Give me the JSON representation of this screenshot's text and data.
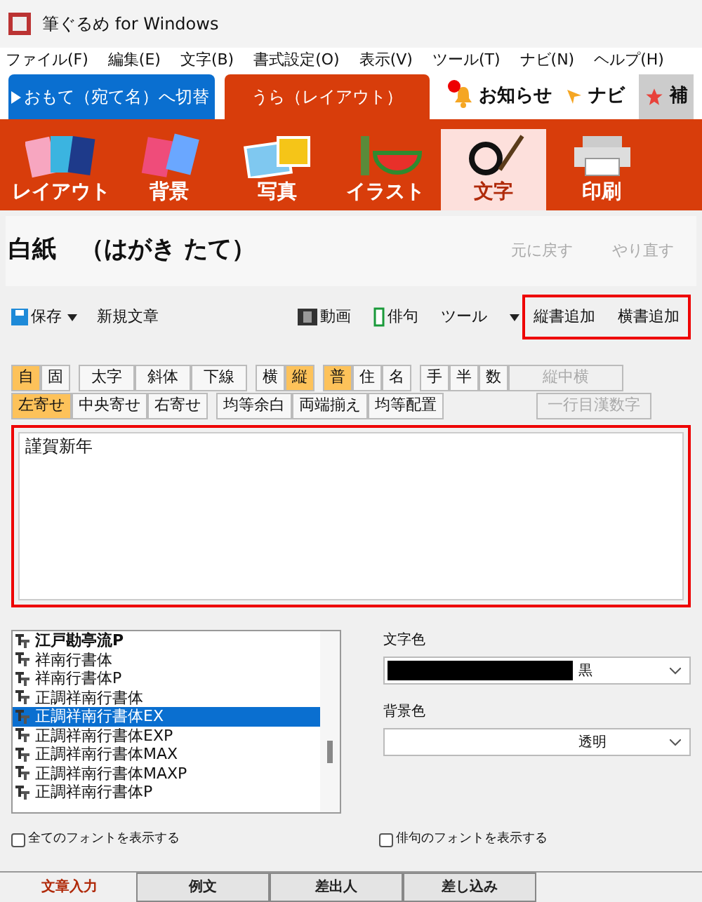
{
  "window": {
    "title": "筆ぐるめ for Windows"
  },
  "menu": [
    "ファイル(F)",
    "編集(E)",
    "文字(B)",
    "書式設定(O)",
    "表示(V)",
    "ツール(T)",
    "ナビ(N)",
    "ヘルプ(H)"
  ],
  "mode_tabs": [
    {
      "kind": "switch",
      "label": "おもて（宛て名）へ切替"
    },
    {
      "kind": "tab",
      "label": "うら（レイアウト）"
    }
  ],
  "header_links": [
    {
      "kind": "notice",
      "label": "お知らせ",
      "alert": true
    },
    {
      "kind": "navi",
      "label": "ナビ"
    },
    {
      "kind": "star",
      "label": "補"
    }
  ],
  "categories": [
    {
      "kind": "layout",
      "label": "レイアウト",
      "selected": false
    },
    {
      "kind": "background",
      "label": "背景",
      "selected": false
    },
    {
      "kind": "photo",
      "label": "写真",
      "selected": false
    },
    {
      "kind": "illust",
      "label": "イラスト",
      "selected": false
    },
    {
      "kind": "text",
      "label": "文字",
      "selected": true
    },
    {
      "kind": "print",
      "label": "印刷",
      "selected": false
    }
  ],
  "document_title": "白紙　（はがき たて）",
  "history": [
    {
      "label": "元に戻す",
      "disabled": true
    },
    {
      "label": "やり直す",
      "disabled": true
    }
  ],
  "toolbar": [
    {
      "kind": "save",
      "label": "保存"
    },
    {
      "kind": "new",
      "label": "新規文章"
    },
    {
      "kind": "video",
      "label": "動画"
    },
    {
      "kind": "haiku",
      "label": "俳句"
    },
    {
      "kind": "menu",
      "label": "ツール"
    }
  ],
  "highlighted_buttons": [
    "縦書追加",
    "横書追加"
  ],
  "format_rows": [
    [
      [
        {
          "label": "自",
          "selected": true,
          "disabled": false
        },
        {
          "label": "固",
          "selected": false,
          "disabled": false
        }
      ],
      [
        {
          "label": "太字",
          "selected": false,
          "disabled": false
        },
        {
          "label": "斜体",
          "selected": false,
          "disabled": false
        },
        {
          "label": "下線",
          "selected": false,
          "disabled": false
        }
      ],
      [
        {
          "label": "横",
          "selected": false,
          "disabled": false
        },
        {
          "label": "縦",
          "selected": true,
          "disabled": false
        }
      ],
      [
        {
          "label": "普",
          "selected": true,
          "disabled": false
        },
        {
          "label": "住",
          "selected": false,
          "disabled": false
        },
        {
          "label": "名",
          "selected": false,
          "disabled": false
        }
      ],
      [
        {
          "label": "手",
          "selected": false,
          "disabled": false
        },
        {
          "label": "半",
          "selected": false,
          "disabled": false
        },
        {
          "label": "数",
          "selected": false,
          "disabled": false
        },
        {
          "label": "縦中横",
          "selected": false,
          "disabled": true
        }
      ]
    ],
    [
      [
        {
          "label": "左寄せ",
          "selected": true,
          "disabled": false
        },
        {
          "label": "中央寄せ",
          "selected": false,
          "disabled": false
        },
        {
          "label": "右寄せ",
          "selected": false,
          "disabled": false
        }
      ],
      [
        {
          "label": "均等余白",
          "selected": false,
          "disabled": false
        },
        {
          "label": "両端揃え",
          "selected": false,
          "disabled": false
        },
        {
          "label": "均等配置",
          "selected": false,
          "disabled": false
        }
      ],
      [
        {
          "label": "一行目漢数字",
          "selected": false,
          "disabled": true
        }
      ]
    ]
  ],
  "editor": {
    "value": "謹賀新年"
  },
  "fonts": [
    {
      "label": "江戸勘亭流P",
      "selected": false
    },
    {
      "label": "祥南行書体",
      "selected": false
    },
    {
      "label": "祥南行書体P",
      "selected": false
    },
    {
      "label": "正調祥南行書体",
      "selected": false
    },
    {
      "label": "正調祥南行書体EX",
      "selected": true
    },
    {
      "label": "正調祥南行書体EXP",
      "selected": false
    },
    {
      "label": "正調祥南行書体MAX",
      "selected": false
    },
    {
      "label": "正調祥南行書体MAXP",
      "selected": false
    },
    {
      "label": "正調祥南行書体P",
      "selected": false
    }
  ],
  "text_color": {
    "label": "文字色",
    "value": "黒",
    "color": "#000000"
  },
  "background_color": {
    "label": "背景色",
    "value": "透明"
  },
  "checkboxes": [
    {
      "label": "全てのフォントを表示する",
      "checked": false
    },
    {
      "label": "俳句のフォントを表示する",
      "checked": false
    }
  ],
  "bottom_tabs": [
    {
      "label": "文章入力",
      "selected": true
    },
    {
      "label": "例文",
      "selected": false
    },
    {
      "label": "差出人",
      "selected": false
    },
    {
      "label": "差し込み",
      "selected": false
    }
  ]
}
